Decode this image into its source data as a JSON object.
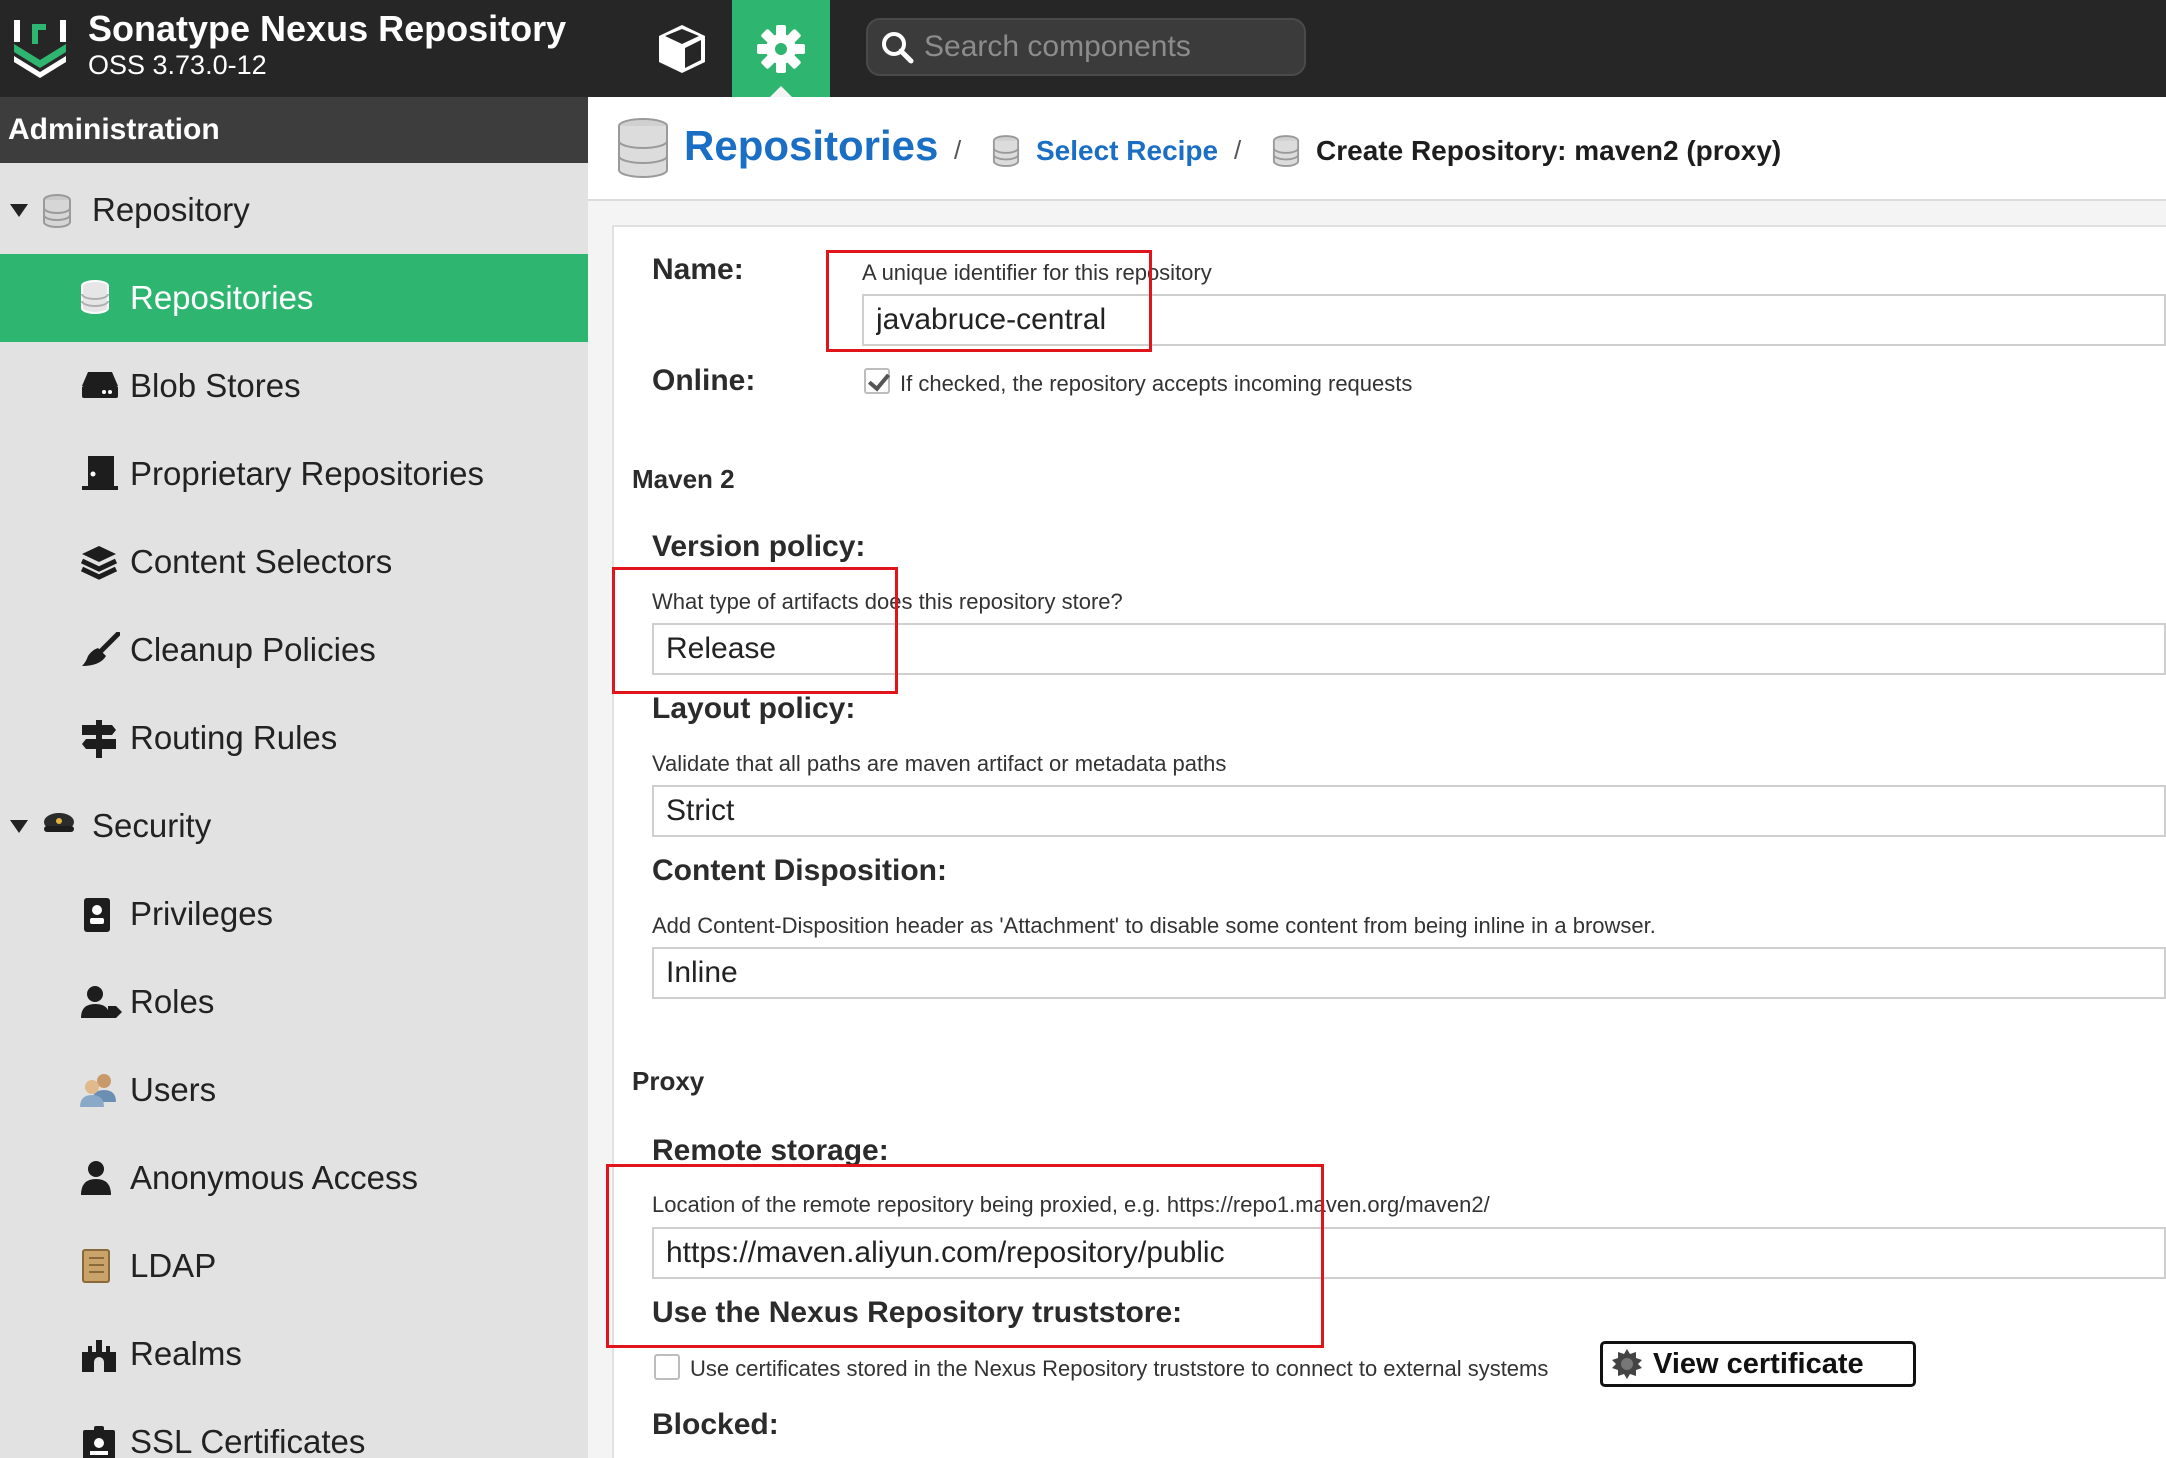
{
  "header": {
    "title": "Sonatype Nexus Repository",
    "version": "OSS 3.73.0-12",
    "search_placeholder": "Search components",
    "accent_color": "#2eb670"
  },
  "sidebar": {
    "section_title": "Administration",
    "items": [
      {
        "label": "Repository",
        "type": "group",
        "icon": "database-icon"
      },
      {
        "label": "Repositories",
        "type": "item",
        "icon": "database-icon",
        "active": true
      },
      {
        "label": "Blob Stores",
        "type": "item",
        "icon": "hard-drive-icon"
      },
      {
        "label": "Proprietary Repositories",
        "type": "item",
        "icon": "door-icon"
      },
      {
        "label": "Content Selectors",
        "type": "item",
        "icon": "layers-icon"
      },
      {
        "label": "Cleanup Policies",
        "type": "item",
        "icon": "broom-icon"
      },
      {
        "label": "Routing Rules",
        "type": "item",
        "icon": "signpost-icon"
      },
      {
        "label": "Security",
        "type": "group",
        "icon": "police-cap-icon"
      },
      {
        "label": "Privileges",
        "type": "item",
        "icon": "id-badge-icon"
      },
      {
        "label": "Roles",
        "type": "item",
        "icon": "user-tag-icon"
      },
      {
        "label": "Users",
        "type": "item",
        "icon": "users-icon"
      },
      {
        "label": "Anonymous Access",
        "type": "item",
        "icon": "user-icon"
      },
      {
        "label": "LDAP",
        "type": "item",
        "icon": "address-book-icon"
      },
      {
        "label": "Realms",
        "type": "item",
        "icon": "castle-icon"
      },
      {
        "label": "SSL Certificates",
        "type": "item",
        "icon": "certificate-icon"
      }
    ]
  },
  "breadcrumb": {
    "root": "Repositories",
    "middle": "Select Recipe",
    "current": "Create Repository: maven2 (proxy)",
    "separator": "/"
  },
  "form": {
    "name": {
      "label": "Name:",
      "hint": "A unique identifier for this repository",
      "value": "javabruce-central"
    },
    "online": {
      "label": "Online:",
      "hint": "If checked, the repository accepts incoming requests",
      "checked": true
    },
    "maven_section": "Maven 2",
    "version_policy": {
      "label": "Version policy:",
      "hint": "What type of artifacts does this repository store?",
      "value": "Release"
    },
    "layout_policy": {
      "label": "Layout policy:",
      "hint": "Validate that all paths are maven artifact or metadata paths",
      "value": "Strict"
    },
    "content_disposition": {
      "label": "Content Disposition:",
      "hint": "Add Content-Disposition header as 'Attachment' to disable some content from being inline in a browser.",
      "value": "Inline"
    },
    "proxy_section": "Proxy",
    "remote_storage": {
      "label": "Remote storage:",
      "hint": "Location of the remote repository being proxied, e.g. https://repo1.maven.org/maven2/",
      "value": "https://maven.aliyun.com/repository/public"
    },
    "truststore": {
      "label": "Use the Nexus Repository truststore:",
      "hint": "Use certificates stored in the Nexus Repository truststore to connect to external systems",
      "checked": false,
      "button_label": "View certificate"
    },
    "blocked": {
      "label": "Blocked:"
    }
  }
}
